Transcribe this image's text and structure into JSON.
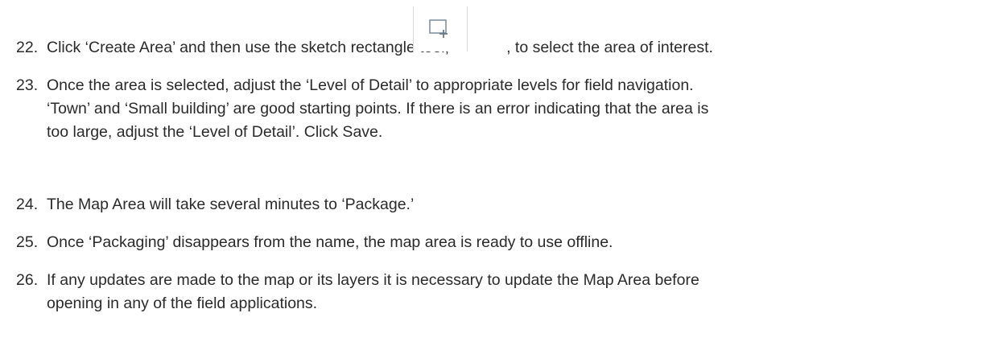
{
  "steps": [
    {
      "number": "22.",
      "text_before_icon": "Click ‘Create Area’ and then use the sketch rectangle tool,",
      "text_after_icon": ", to select the area of interest.",
      "icon": "sketch-rectangle-icon"
    },
    {
      "number": "23.",
      "lines": [
        "Once the area is selected, adjust the ‘Level of Detail’ to appropriate levels for field navigation.",
        "‘Town’ and ‘Small building’ are good starting points. If there is an error indicating that the area is",
        "too large, adjust the ‘Level of Detail’. Click Save."
      ]
    },
    {
      "number": "24.",
      "lines": [
        "The Map Area will take several minutes to ‘Package.’"
      ]
    },
    {
      "number": "25.",
      "lines": [
        "Once ‘Packaging’ disappears from the name, the map area is ready to use offline."
      ]
    },
    {
      "number": "26.",
      "lines": [
        "If any updates are made to the map or its layers it is necessary to update the Map Area before",
        "opening in any of the field applications."
      ]
    }
  ],
  "colors": {
    "text": "#2a2a2a",
    "icon_stroke": "#7a8a99"
  }
}
